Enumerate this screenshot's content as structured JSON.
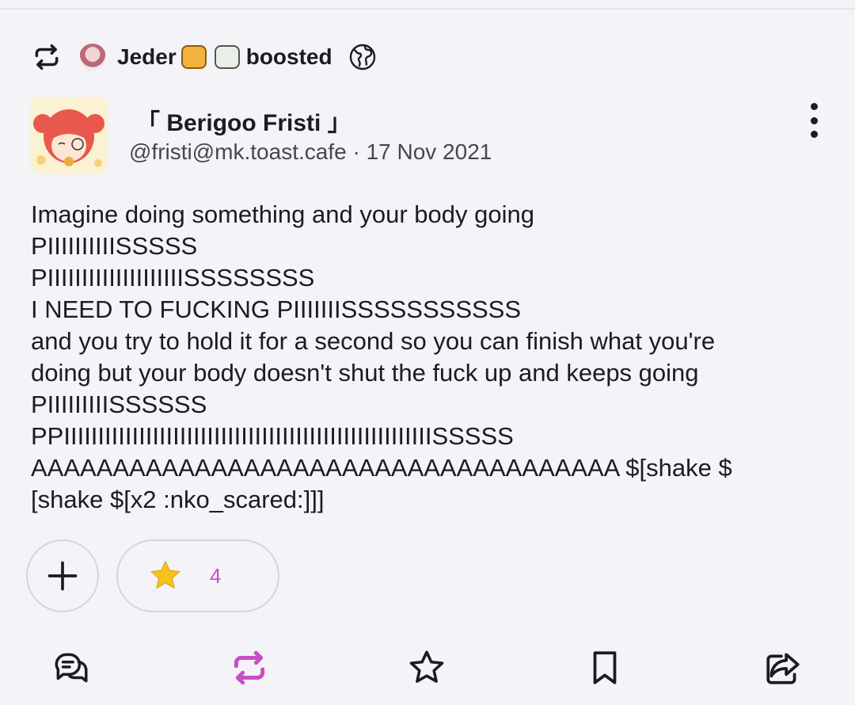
{
  "boost": {
    "booster_name": "Jeder",
    "label": "boosted"
  },
  "author": {
    "display_name": "「 Berigoo Fristi 」",
    "handle_and_date": "@fristi@mk.toast.cafe · 17 Nov 2021"
  },
  "post": {
    "lines": [
      "Imagine doing something and your body going",
      "PIIIIIIIIIISSSSS",
      "PIIIIIIIIIIIIIIIIIIIISSSSSSSS",
      "I NEED TO FUCKING PIIIIIIISSSSSSSSSSS",
      "and you try to hold it for a second so you can finish what you're",
      "doing but your body doesn't shut the fuck up and keeps going",
      "PIIIIIIIIISSSSSS",
      "PPIIIIIIIIIIIIIIIIIIIIIIIIIIIIIIIIIIIIIIIIIIIIIIIIIIIIIISSSSS",
      "AAAAAAAAAAAAAAAAAAAAAAAAAAAAAAAAAAAA $[shake $",
      "[shake $[x2 :nko_scared:]]]"
    ]
  },
  "reactions": [
    {
      "emoji": "star",
      "count": "4"
    }
  ],
  "colors": {
    "accent": "#c84fc4",
    "star": "#f7c21a",
    "background": "#f4f3f8"
  }
}
